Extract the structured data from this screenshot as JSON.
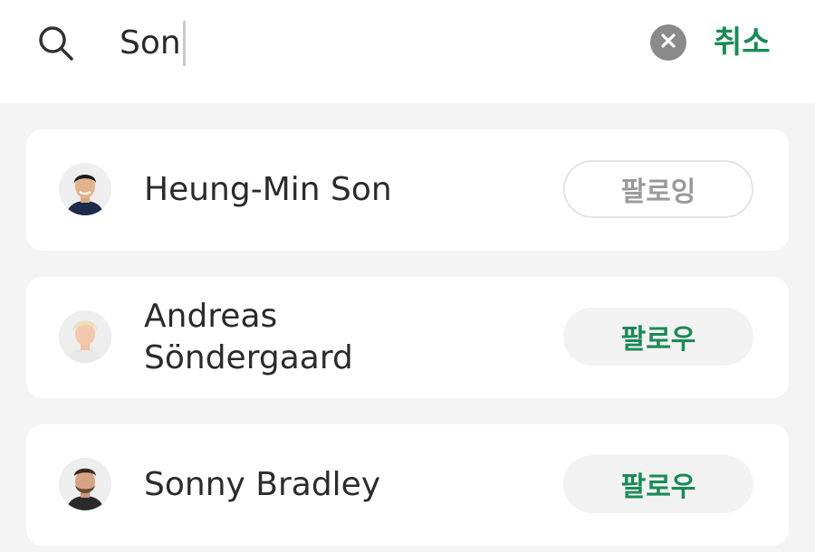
{
  "search": {
    "value": "Son"
  },
  "header": {
    "cancel_label": "취소"
  },
  "results": [
    {
      "name": "Heung-Min Son",
      "follow_label": "팔로잉",
      "following": true
    },
    {
      "name": "Andreas Söndergaard",
      "follow_label": "팔로우",
      "following": false
    },
    {
      "name": "Sonny Bradley",
      "follow_label": "팔로우",
      "following": false
    }
  ],
  "colors": {
    "accent": "#1a8a57",
    "background": "#f4f4f4",
    "card": "#ffffff",
    "following_text": "#9a9a9a"
  },
  "icons": {
    "search": "search-icon",
    "clear": "clear-icon"
  }
}
